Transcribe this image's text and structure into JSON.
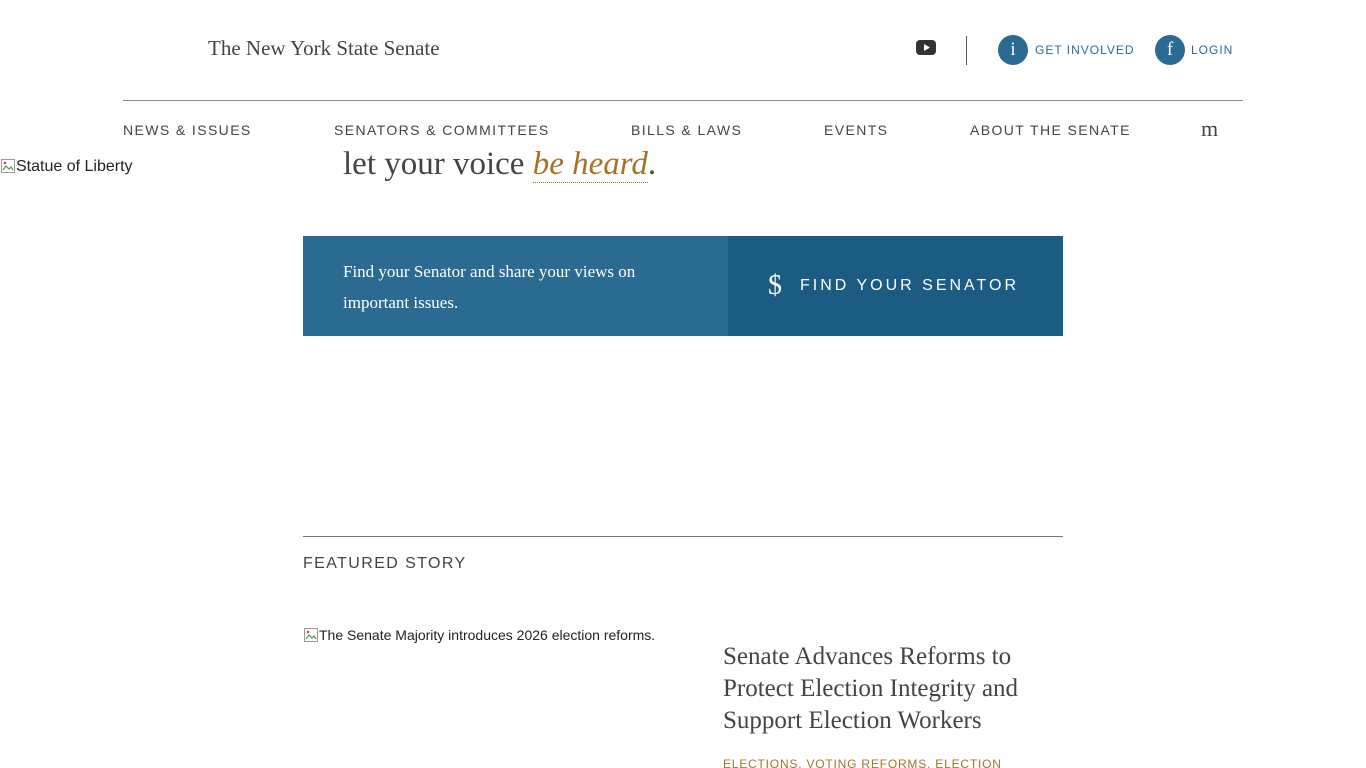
{
  "header": {
    "site_title": "The New York State Senate",
    "get_involved": {
      "icon_glyph": "i",
      "label": "GET INVOLVED"
    },
    "login": {
      "icon_glyph": "f",
      "label": "LOGIN"
    }
  },
  "nav": {
    "items": [
      {
        "label": "NEWS & ISSUES"
      },
      {
        "label": "SENATORS & COMMITTEES"
      },
      {
        "label": "BILLS & LAWS"
      },
      {
        "label": "EVENTS"
      },
      {
        "label": "ABOUT THE SENATE"
      }
    ],
    "menu_glyph": "m"
  },
  "hero": {
    "image_alt": "Statue of Liberty",
    "heading_prefix": "let your voice ",
    "heading_accent": "be heard",
    "heading_suffix": "."
  },
  "cta": {
    "text": "Find your Senator and share your views on important issues.",
    "button_glyph": "$",
    "button_label": "FIND YOUR SENATOR"
  },
  "featured": {
    "section_label": "FEATURED STORY",
    "image_alt": "The Senate Majority introduces 2026 election reforms.",
    "title": "Senate Advances Reforms to Protect Election Integrity and Support Election Workers",
    "tags": "ELECTIONS, VOTING REFORMS, ELECTION"
  },
  "colors": {
    "primary_blue": "#2b6a91",
    "dark_blue": "#1c5c83",
    "accent_gold": "#a37428"
  },
  "icons": {
    "youtube": "youtube-icon",
    "broken_image": "broken-image-icon"
  }
}
